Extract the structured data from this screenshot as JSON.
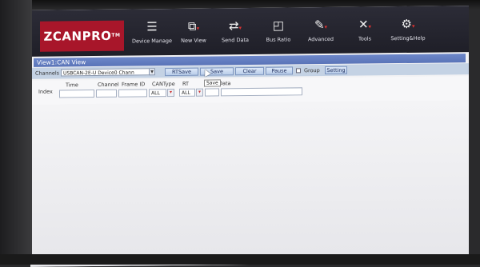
{
  "app": {
    "logo": "ZCANPRO",
    "logo_mark": "TM"
  },
  "toolbar": {
    "items": [
      {
        "label": "Device Manage",
        "icon": "device-manage-icon"
      },
      {
        "label": "New View",
        "icon": "new-view-icon"
      },
      {
        "label": "Send Data",
        "icon": "send-data-icon"
      },
      {
        "label": "Bus Ratio",
        "icon": "bus-ratio-icon"
      },
      {
        "label": "Advanced",
        "icon": "advanced-icon"
      },
      {
        "label": "Tools",
        "icon": "tools-icon"
      },
      {
        "label": "Setting&Help",
        "icon": "gear-icon"
      }
    ]
  },
  "view": {
    "title": "View1:CAN View",
    "channels_label": "Channels",
    "channel_value": "USBCAN-2E-U Device0 Chann",
    "buttons": {
      "rtsave": "RTSave",
      "save": "Save",
      "clear": "Clear",
      "pause": "Pause",
      "setting": "Setting"
    },
    "group_label": "Group",
    "tooltip": "Save"
  },
  "table": {
    "columns": {
      "index": "Index",
      "time": "Time",
      "channel": "Channel",
      "frame_id": "Frame ID",
      "cantype": "CANType",
      "rt": "RT",
      "data": "Data"
    },
    "filters": {
      "cantype": "ALL",
      "rt": "ALL"
    }
  }
}
